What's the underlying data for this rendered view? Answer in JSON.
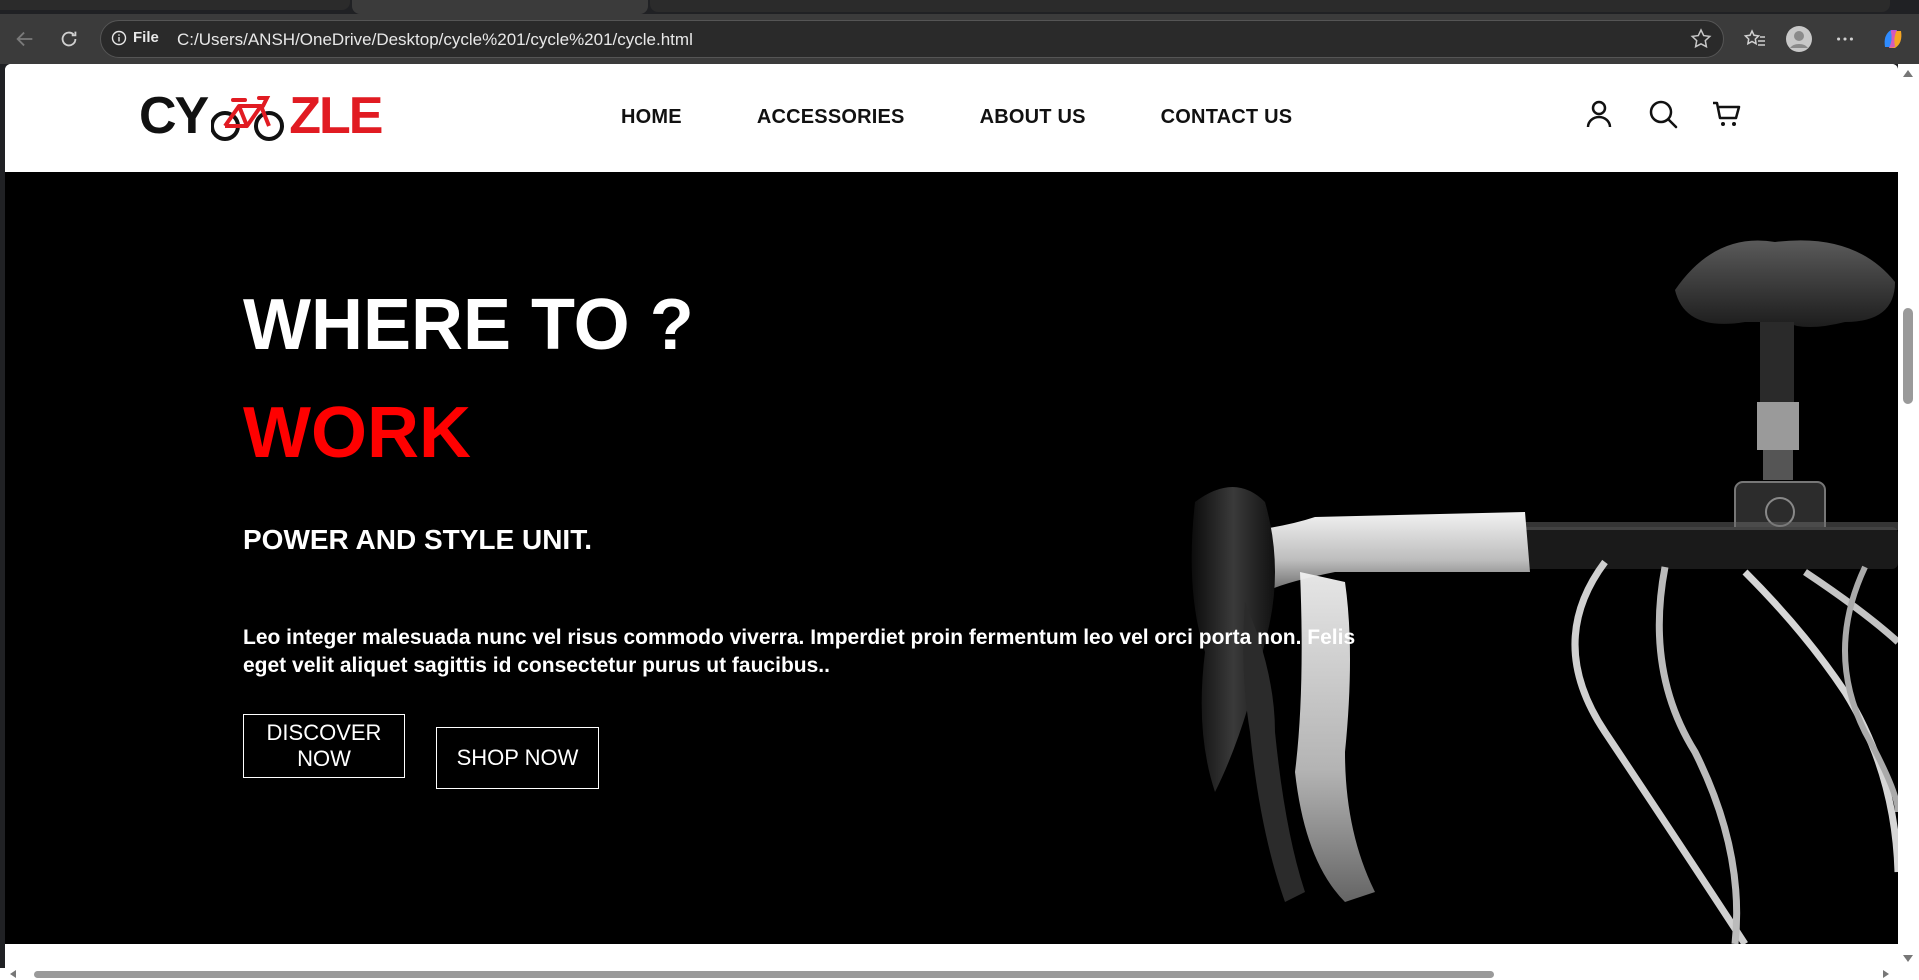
{
  "browser": {
    "address_prefix": "File",
    "url": "C:/Users/ANSH/OneDrive/Desktop/cycle%201/cycle%201/cycle.html"
  },
  "site": {
    "logo": {
      "left_text": "CY",
      "right_text": "ZLE",
      "accent_color": "#e11b22"
    },
    "nav": [
      "HOME",
      "ACCESSORIES",
      "ABOUT US",
      "CONTACT US"
    ]
  },
  "hero": {
    "title": "WHERE TO ?",
    "accent_word": "WORK",
    "accent_color": "#ff0000",
    "subtitle": "POWER AND STYLE UNIT.",
    "description": "Leo integer malesuada nunc vel risus commodo viverra. Imperdiet proin fermentum leo vel orci porta non. Felis eget velit aliquet sagittis id consectetur purus ut faucibus..",
    "discover_label": "DISCOVER NOW",
    "shop_label": "SHOP NOW"
  }
}
